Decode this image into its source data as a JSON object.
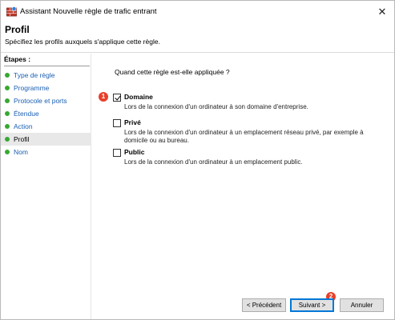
{
  "window": {
    "title": "Assistant Nouvelle règle de trafic entrant",
    "close_glyph": "✕"
  },
  "header": {
    "title": "Profil",
    "description": "Spécifiez les profils auxquels s'applique cette règle."
  },
  "sidebar": {
    "heading": "Étapes :",
    "steps": [
      {
        "label": "Type de règle"
      },
      {
        "label": "Programme"
      },
      {
        "label": "Protocole et ports"
      },
      {
        "label": "Étendue"
      },
      {
        "label": "Action"
      },
      {
        "label": "Profil",
        "current": true
      },
      {
        "label": "Nom"
      }
    ]
  },
  "main": {
    "question": "Quand cette règle est-elle appliquée ?",
    "options": [
      {
        "label": "Domaine",
        "checked": true,
        "description": "Lors de la connexion d'un ordinateur à son domaine d'entreprise."
      },
      {
        "label": "Privé",
        "checked": false,
        "description": "Lors de la connexion d'un ordinateur à un emplacement réseau privé, par exemple à domicile ou au bureau."
      },
      {
        "label": "Public",
        "checked": false,
        "description": "Lors de la connexion d'un ordinateur à un emplacement public."
      }
    ]
  },
  "annotations": {
    "badge1": "1",
    "badge2": "2"
  },
  "buttons": {
    "back": "< Précédent",
    "next": "Suivant >",
    "cancel": "Annuler"
  },
  "colors": {
    "badge": "#e8402a",
    "step_dot": "#38a832",
    "link": "#1a5fb4"
  }
}
